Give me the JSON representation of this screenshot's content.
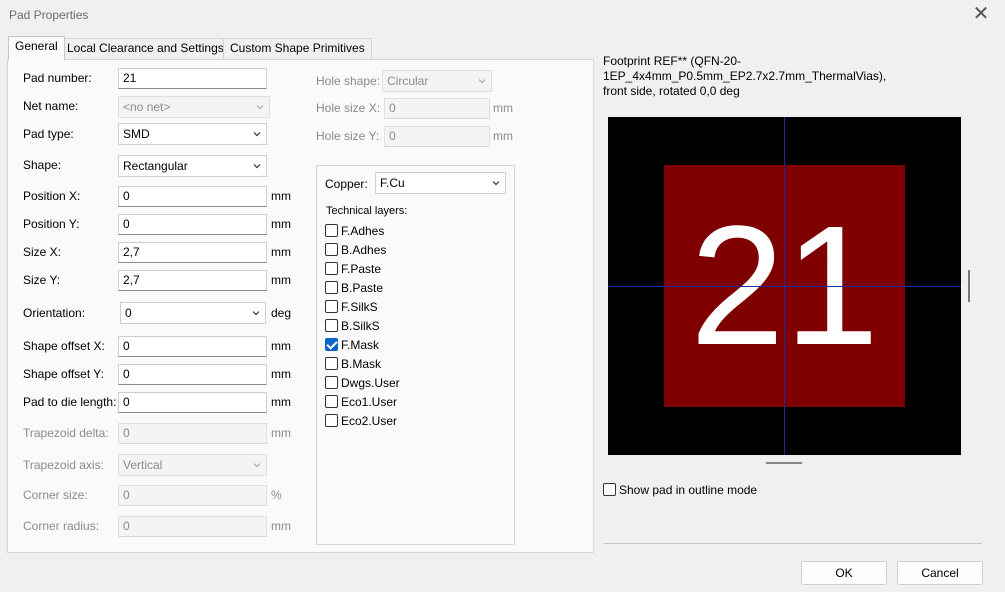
{
  "window": {
    "title": "Pad Properties"
  },
  "tabs": [
    {
      "label": "General",
      "active": true
    },
    {
      "label": "Local Clearance and Settings",
      "active": false
    },
    {
      "label": "Custom Shape Primitives",
      "active": false
    }
  ],
  "fields": {
    "pad_number": {
      "label": "Pad number:",
      "value": "21"
    },
    "net_name": {
      "label": "Net name:",
      "value": "<no net>"
    },
    "pad_type": {
      "label": "Pad type:",
      "value": "SMD"
    },
    "shape": {
      "label": "Shape:",
      "value": "Rectangular"
    },
    "position_x": {
      "label": "Position X:",
      "value": "0",
      "unit": "mm"
    },
    "position_y": {
      "label": "Position Y:",
      "value": "0",
      "unit": "mm"
    },
    "size_x": {
      "label": "Size X:",
      "value": "2,7",
      "unit": "mm"
    },
    "size_y": {
      "label": "Size Y:",
      "value": "2,7",
      "unit": "mm"
    },
    "orientation": {
      "label": "Orientation:",
      "value": "0",
      "unit": "deg"
    },
    "shape_offset_x": {
      "label": "Shape offset X:",
      "value": "0",
      "unit": "mm"
    },
    "shape_offset_y": {
      "label": "Shape offset Y:",
      "value": "0",
      "unit": "mm"
    },
    "pad_to_die": {
      "label": "Pad to die length:",
      "value": "0",
      "unit": "mm"
    },
    "trapezoid_delta": {
      "label": "Trapezoid delta:",
      "value": "0",
      "unit": "mm"
    },
    "trapezoid_axis": {
      "label": "Trapezoid axis:",
      "value": "Vertical"
    },
    "corner_size": {
      "label": "Corner size:",
      "value": "0",
      "unit": "%"
    },
    "corner_radius": {
      "label": "Corner radius:",
      "value": "0",
      "unit": "mm"
    }
  },
  "hole": {
    "shape": {
      "label": "Hole shape:",
      "value": "Circular"
    },
    "size_x": {
      "label": "Hole size X:",
      "value": "0",
      "unit": "mm"
    },
    "size_y": {
      "label": "Hole size Y:",
      "value": "0",
      "unit": "mm"
    }
  },
  "layers": {
    "copper_label": "Copper:",
    "copper_value": "F.Cu",
    "technical_label": "Technical layers:",
    "items": [
      {
        "label": "F.Adhes",
        "checked": false
      },
      {
        "label": "B.Adhes",
        "checked": false
      },
      {
        "label": "F.Paste",
        "checked": false
      },
      {
        "label": "B.Paste",
        "checked": false
      },
      {
        "label": "F.SilkS",
        "checked": false
      },
      {
        "label": "B.SilkS",
        "checked": false
      },
      {
        "label": "F.Mask",
        "checked": true
      },
      {
        "label": "B.Mask",
        "checked": false
      },
      {
        "label": "Dwgs.User",
        "checked": false
      },
      {
        "label": "Eco1.User",
        "checked": false
      },
      {
        "label": "Eco2.User",
        "checked": false
      }
    ]
  },
  "preview": {
    "caption_line1": "Footprint REF** (QFN-20-1EP_4x4mm_P0.5mm_EP2.7x2.7mm_ThermalVias),",
    "caption_line2": "front side, rotated 0,0 deg",
    "pad_label": "21",
    "pad_color": "#7f0000",
    "background_color": "#000000",
    "crosshair_color": "#1a2a9a",
    "outline_mode_label": "Show pad in outline mode",
    "outline_mode_checked": false
  },
  "buttons": {
    "ok": "OK",
    "cancel": "Cancel"
  },
  "icons": {
    "close": "close-icon",
    "dropdown": "chevron-down-icon"
  }
}
